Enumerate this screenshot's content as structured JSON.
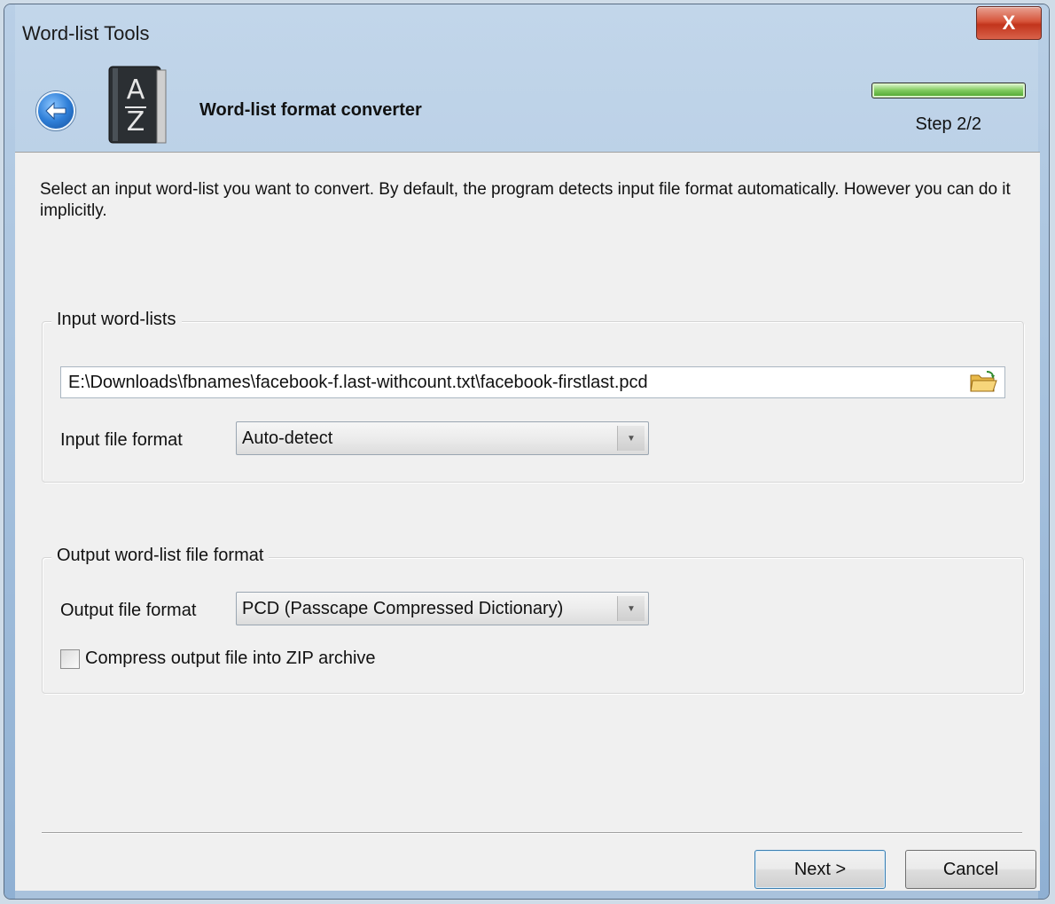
{
  "window": {
    "title": "Word-list Tools",
    "close_label": "X"
  },
  "header": {
    "wizard_title": "Word-list format converter",
    "step_label": "Step 2/2",
    "progress_percent": 100,
    "book_letters": [
      "A",
      "Z"
    ]
  },
  "intro_text": "Select an input word-list you want to convert. By default, the program detects input file format automatically. However you can do it implicitly.",
  "input_group": {
    "legend": "Input word-lists",
    "path_value": "E:\\Downloads\\fbnames\\facebook-f.last-withcount.txt\\facebook-firstlast.pcd",
    "format_label": "Input file format",
    "format_selected": "Auto-detect"
  },
  "output_group": {
    "legend": "Output word-list file format",
    "format_label": "Output file format",
    "format_selected": "PCD (Passcape Compressed Dictionary)",
    "compress_label": "Compress output file into ZIP archive",
    "compress_checked": false
  },
  "buttons": {
    "next_label": "Next >",
    "cancel_label": "Cancel"
  },
  "icons": {
    "back": "back-arrow-icon",
    "book": "dictionary-book-icon",
    "folder": "open-folder-icon",
    "combo_arrow": "chevron-down-icon"
  }
}
